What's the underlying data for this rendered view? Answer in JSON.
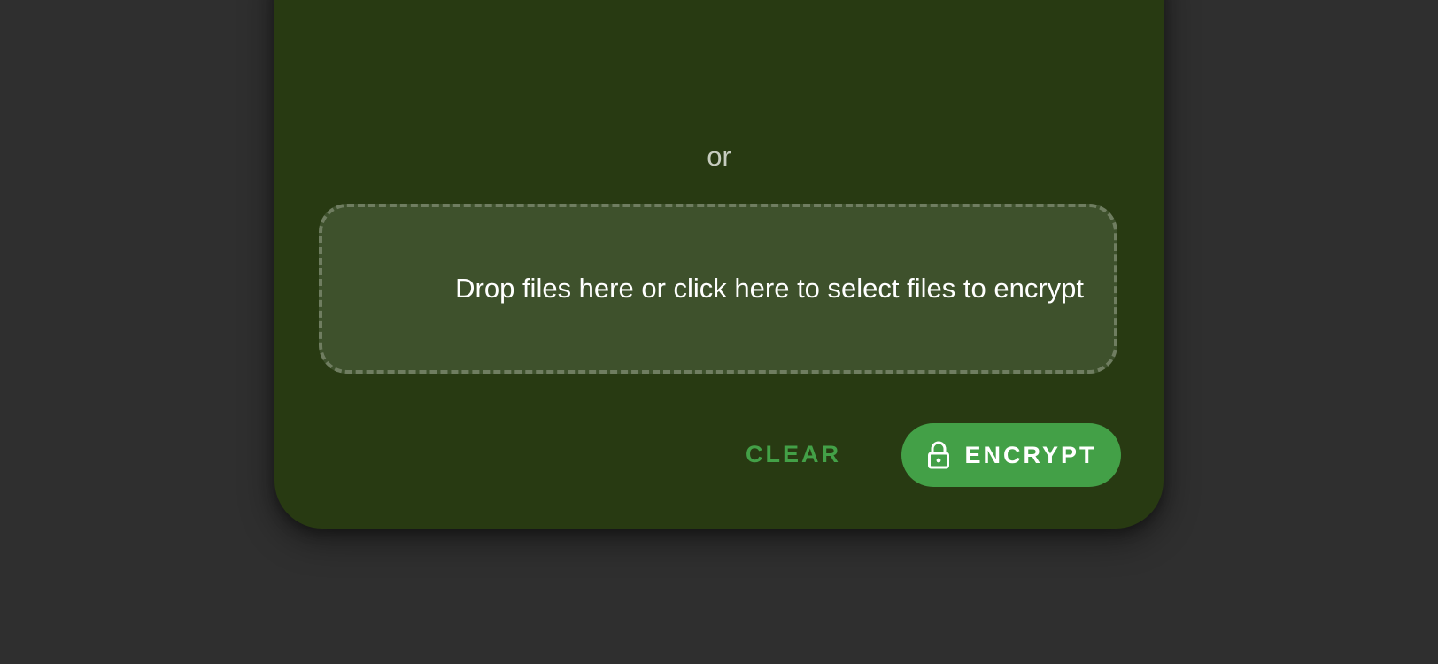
{
  "upload": {
    "separator_text": "or",
    "dropzone_label": "Drop files here or click here to select files to encrypt"
  },
  "actions": {
    "clear_label": "CLEAR",
    "encrypt_label": "ENCRYPT",
    "encrypt_icon": "lock-icon"
  },
  "colors": {
    "background": "#2f2f2f",
    "card": "#283a12",
    "dropzone": "#3e512c",
    "accent": "#43a047"
  }
}
